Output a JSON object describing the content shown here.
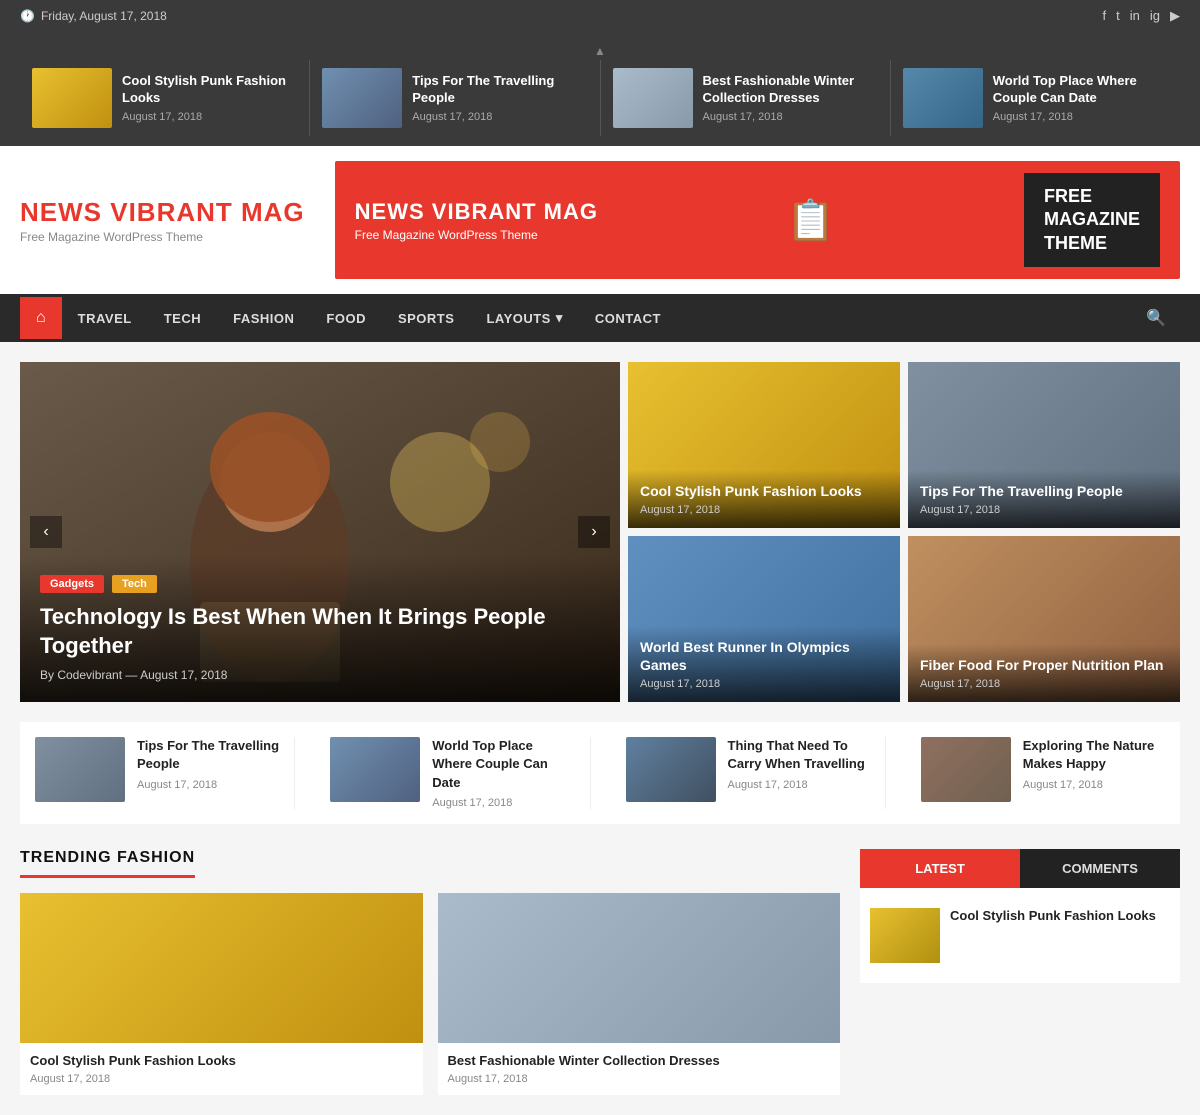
{
  "topbar": {
    "date": "Friday, August 17, 2018",
    "social_icons": [
      "f",
      "t",
      "in",
      "ig",
      "yt"
    ]
  },
  "ticker": {
    "toggle_icon": "▲",
    "items": [
      {
        "title": "Cool Stylish Punk Fashion Looks",
        "date": "August 17, 2018",
        "img_class": "ph-punk"
      },
      {
        "title": "Tips For The Travelling People",
        "date": "August 17, 2018",
        "img_class": "ph-travel"
      },
      {
        "title": "Best Fashionable Winter Collection Dresses",
        "date": "August 17, 2018",
        "img_class": "ph-gray"
      },
      {
        "title": "World Top Place Where Couple Can Date",
        "date": "August 17, 2018",
        "img_class": "ph-blue"
      }
    ]
  },
  "logo": {
    "name1": "NEWS VIBRANT ",
    "name2": "MAG",
    "tagline": "Free Magazine WordPress Theme"
  },
  "banner": {
    "title": "NEWS VIBRANT MAG",
    "subtitle": "Free Magazine WordPress Theme",
    "icon": "📋",
    "cta": "FREE\nMAGAZINE\nTHEME"
  },
  "nav": {
    "home_icon": "⌂",
    "items": [
      {
        "label": "TRAVEL"
      },
      {
        "label": "TECH"
      },
      {
        "label": "FASHION"
      },
      {
        "label": "FOOD"
      },
      {
        "label": "SPORTS"
      },
      {
        "label": "LAYOUTS",
        "has_dropdown": true
      },
      {
        "label": "CONTACT"
      }
    ],
    "search_icon": "🔍"
  },
  "hero": {
    "main": {
      "tags": [
        "Gadgets",
        "Tech"
      ],
      "title": "Technology Is Best When When It Brings People Together",
      "author": "Codevibrant",
      "date": "August 17, 2018"
    },
    "side_cards": [
      {
        "title": "Cool Stylish Punk Fashion Looks",
        "date": "August 17, 2018",
        "img_class": "ph-punk"
      },
      {
        "title": "Tips For The Travelling People",
        "date": "August 17, 2018",
        "img_class": "ph-travel2"
      },
      {
        "title": "World Best Runner In Olympics Games",
        "date": "August 17, 2018",
        "img_class": "ph-sports"
      },
      {
        "title": "Fiber Food For Proper Nutrition Plan",
        "date": "August 17, 2018",
        "img_class": "ph-food"
      }
    ]
  },
  "articles_row": [
    {
      "title": "Tips For The Travelling People",
      "date": "August 17, 2018",
      "img_class": "ph-travel"
    },
    {
      "title": "World Top Place Where Couple Can Date",
      "date": "August 17, 2018",
      "img_class": "ph-blue"
    },
    {
      "title": "Thing That Need To Carry When Travelling",
      "date": "August 17, 2018",
      "img_class": "ph-nature"
    },
    {
      "title": "Exploring The Nature Makes Happy",
      "date": "August 17, 2018",
      "img_class": "ph-people"
    }
  ],
  "trending": {
    "section_label": "TRENDING FASHION",
    "cards": [
      {
        "title": "Cool Stylish Punk Fashion Looks",
        "date": "August 17, 2018",
        "img_class": "ph-punk"
      },
      {
        "title": "Best Fashionable Winter Collection Dresses",
        "date": "August 17, 2018",
        "img_class": "ph-gray"
      }
    ]
  },
  "sidebar": {
    "tabs": [
      {
        "label": "LATEST",
        "active": true
      },
      {
        "label": "COMMENTS",
        "active": false
      }
    ],
    "articles": [
      {
        "title": "Cool Stylish Punk Fashion Looks",
        "img_class": "ph-sidebar"
      }
    ]
  }
}
